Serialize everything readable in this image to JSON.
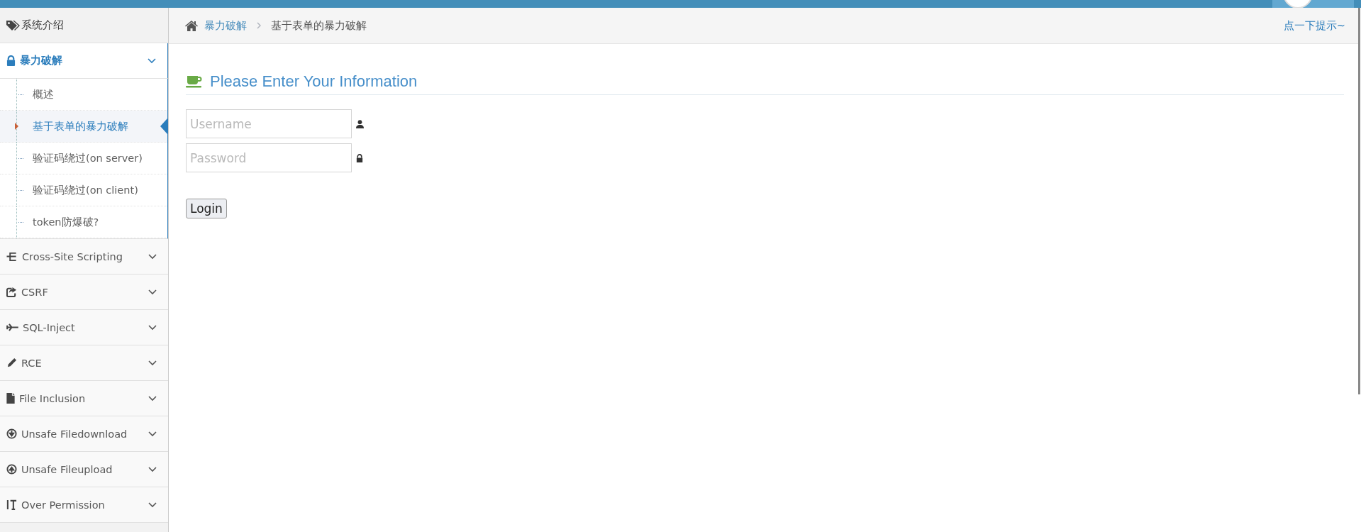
{
  "sidebar": {
    "intro": {
      "label": "系统介绍"
    },
    "groups": [
      {
        "label": "暴力破解",
        "expanded": true,
        "children": [
          {
            "label": "概述",
            "selected": false
          },
          {
            "label": "基于表单的暴力破解",
            "selected": true
          },
          {
            "label": "验证码绕过(on server)",
            "selected": false
          },
          {
            "label": "验证码绕过(on client)",
            "selected": false
          },
          {
            "label": "token防爆破?",
            "selected": false
          }
        ]
      },
      {
        "label": "Cross-Site Scripting",
        "expanded": false
      },
      {
        "label": "CSRF",
        "expanded": false
      },
      {
        "label": "SQL-Inject",
        "expanded": false
      },
      {
        "label": "RCE",
        "expanded": false
      },
      {
        "label": "File Inclusion",
        "expanded": false
      },
      {
        "label": "Unsafe Filedownload",
        "expanded": false
      },
      {
        "label": "Unsafe Fileupload",
        "expanded": false
      },
      {
        "label": "Over Permission",
        "expanded": false
      }
    ]
  },
  "breadcrumb": [
    "暴力破解",
    "基于表单的暴力破解"
  ],
  "hint_link": "点一下提示~",
  "form": {
    "title": "Please Enter Your Information",
    "fields": [
      {
        "kind": "user",
        "placeholder": "Username"
      },
      {
        "kind": "lock",
        "placeholder": "Password"
      }
    ],
    "button": "Login"
  }
}
